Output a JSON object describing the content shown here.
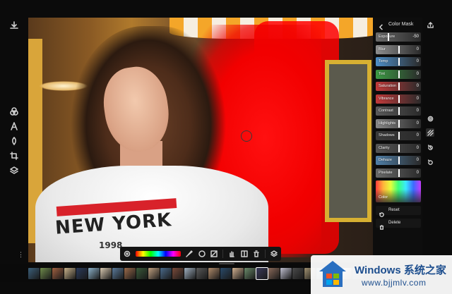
{
  "panel": {
    "title": "Color Mask",
    "sliders": [
      {
        "label": "Exposure",
        "value": "-50",
        "color": "#6b6b6b"
      },
      {
        "label": "Blur",
        "value": "0",
        "color": "#8f8f8f"
      },
      {
        "label": "Temp",
        "value": "0",
        "color": "#4e8fc8"
      },
      {
        "label": "Tint",
        "value": "0",
        "color": "#3c9a44"
      },
      {
        "label": "Saturation",
        "value": "0",
        "color": "#c23a3a"
      },
      {
        "label": "Vibrance",
        "value": "0",
        "color": "#c23a3a"
      },
      {
        "label": "Contrast",
        "value": "0",
        "color": "#5a5a5a"
      },
      {
        "label": "Highlights",
        "value": "0",
        "color": "#888888"
      },
      {
        "label": "Shadows",
        "value": "0",
        "color": "#3a3a3a"
      },
      {
        "label": "Clarity",
        "value": "0",
        "color": "#555555"
      },
      {
        "label": "Dehaze",
        "value": "0",
        "color": "#4f7fa8"
      },
      {
        "label": "Pixelate",
        "value": "0",
        "color": "#6a6a6a"
      }
    ],
    "color_label": "Color",
    "reset_label": "Reset",
    "delete_label": "Delete"
  },
  "canvas": {
    "shirt_text": "NEW YORK",
    "shirt_year": "1998",
    "mask_color": "#ff0000"
  },
  "filmstrip": {
    "thumbnail_colors": [
      "#3b5f7a",
      "#6e8a4a",
      "#a06040",
      "#c8b28a",
      "#2a3a5a",
      "#8ab0c8",
      "#d8c8b0",
      "#5a7a9a",
      "#9a6a4a",
      "#3a5a3a",
      "#c0a080",
      "#4a6a8a",
      "#7a4a3a",
      "#a0b0c0",
      "#5a5a5a",
      "#b08a6a",
      "#2a4a6a",
      "#d0b090",
      "#6a8a6a",
      "#3a3a5a",
      "#8a6a5a",
      "#c0c0d0",
      "#4a4a4a",
      "#a09070",
      "#5a8aa0",
      "#7a7a5a",
      "#e0d0c0",
      "#3a5a7a"
    ],
    "selected_index": 19
  },
  "watermark": {
    "line1": "Windows 系统之家",
    "line2": "www.bjjmlv.com"
  }
}
